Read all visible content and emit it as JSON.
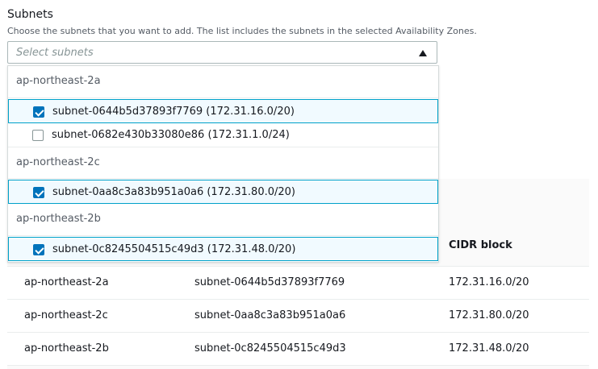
{
  "subnets": {
    "label": "Subnets",
    "description": "Choose the subnets that you want to add. The list includes the subnets in the selected Availability Zones.",
    "placeholder": "Select subnets"
  },
  "dropdown": {
    "groups": [
      {
        "zone": "ap-northeast-2a",
        "options": [
          {
            "text": "subnet-0644b5d37893f7769 (172.31.16.0/20)",
            "checked": true
          },
          {
            "text": "subnet-0682e430b33080e86 (172.31.1.0/24)",
            "checked": false
          }
        ]
      },
      {
        "zone": "ap-northeast-2c",
        "options": [
          {
            "text": "subnet-0aa8c3a83b951a0a6 (172.31.80.0/20)",
            "checked": true
          }
        ]
      },
      {
        "zone": "ap-northeast-2b",
        "options": [
          {
            "text": "subnet-0c8245504515c49d3 (172.31.48.0/20)",
            "checked": true
          }
        ]
      }
    ]
  },
  "table": {
    "cidr_header": "CIDR block",
    "rows": [
      {
        "zone": "ap-northeast-2a",
        "subnet": "subnet-0644b5d37893f7769",
        "cidr": "172.31.16.0/20"
      },
      {
        "zone": "ap-northeast-2c",
        "subnet": "subnet-0aa8c3a83b951a0a6",
        "cidr": "172.31.80.0/20"
      },
      {
        "zone": "ap-northeast-2b",
        "subnet": "subnet-0c8245504515c49d3",
        "cidr": "172.31.48.0/20"
      }
    ]
  },
  "colors": {
    "accent": "#0073bb",
    "selected_border": "#00a1c9",
    "selected_bg": "#f1faff"
  },
  "icons": {
    "caret": "caret-up-icon",
    "checkbox": "checkbox-icon"
  }
}
